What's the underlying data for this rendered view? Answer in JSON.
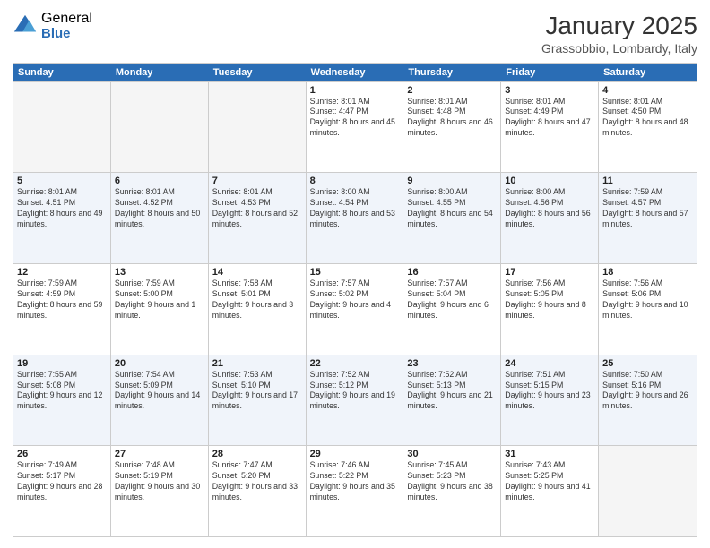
{
  "logo": {
    "general": "General",
    "blue": "Blue"
  },
  "title": "January 2025",
  "subtitle": "Grassobbio, Lombardy, Italy",
  "days": [
    "Sunday",
    "Monday",
    "Tuesday",
    "Wednesday",
    "Thursday",
    "Friday",
    "Saturday"
  ],
  "weeks": [
    [
      {
        "day": "",
        "empty": true
      },
      {
        "day": "",
        "empty": true
      },
      {
        "day": "",
        "empty": true
      },
      {
        "day": "1",
        "sunrise": "8:01 AM",
        "sunset": "4:47 PM",
        "daylight": "8 hours and 45 minutes."
      },
      {
        "day": "2",
        "sunrise": "8:01 AM",
        "sunset": "4:48 PM",
        "daylight": "8 hours and 46 minutes."
      },
      {
        "day": "3",
        "sunrise": "8:01 AM",
        "sunset": "4:49 PM",
        "daylight": "8 hours and 47 minutes."
      },
      {
        "day": "4",
        "sunrise": "8:01 AM",
        "sunset": "4:50 PM",
        "daylight": "8 hours and 48 minutes."
      }
    ],
    [
      {
        "day": "5",
        "sunrise": "8:01 AM",
        "sunset": "4:51 PM",
        "daylight": "8 hours and 49 minutes."
      },
      {
        "day": "6",
        "sunrise": "8:01 AM",
        "sunset": "4:52 PM",
        "daylight": "8 hours and 50 minutes."
      },
      {
        "day": "7",
        "sunrise": "8:01 AM",
        "sunset": "4:53 PM",
        "daylight": "8 hours and 52 minutes."
      },
      {
        "day": "8",
        "sunrise": "8:00 AM",
        "sunset": "4:54 PM",
        "daylight": "8 hours and 53 minutes."
      },
      {
        "day": "9",
        "sunrise": "8:00 AM",
        "sunset": "4:55 PM",
        "daylight": "8 hours and 54 minutes."
      },
      {
        "day": "10",
        "sunrise": "8:00 AM",
        "sunset": "4:56 PM",
        "daylight": "8 hours and 56 minutes."
      },
      {
        "day": "11",
        "sunrise": "7:59 AM",
        "sunset": "4:57 PM",
        "daylight": "8 hours and 57 minutes."
      }
    ],
    [
      {
        "day": "12",
        "sunrise": "7:59 AM",
        "sunset": "4:59 PM",
        "daylight": "8 hours and 59 minutes."
      },
      {
        "day": "13",
        "sunrise": "7:59 AM",
        "sunset": "5:00 PM",
        "daylight": "9 hours and 1 minute."
      },
      {
        "day": "14",
        "sunrise": "7:58 AM",
        "sunset": "5:01 PM",
        "daylight": "9 hours and 3 minutes."
      },
      {
        "day": "15",
        "sunrise": "7:57 AM",
        "sunset": "5:02 PM",
        "daylight": "9 hours and 4 minutes."
      },
      {
        "day": "16",
        "sunrise": "7:57 AM",
        "sunset": "5:04 PM",
        "daylight": "9 hours and 6 minutes."
      },
      {
        "day": "17",
        "sunrise": "7:56 AM",
        "sunset": "5:05 PM",
        "daylight": "9 hours and 8 minutes."
      },
      {
        "day": "18",
        "sunrise": "7:56 AM",
        "sunset": "5:06 PM",
        "daylight": "9 hours and 10 minutes."
      }
    ],
    [
      {
        "day": "19",
        "sunrise": "7:55 AM",
        "sunset": "5:08 PM",
        "daylight": "9 hours and 12 minutes."
      },
      {
        "day": "20",
        "sunrise": "7:54 AM",
        "sunset": "5:09 PM",
        "daylight": "9 hours and 14 minutes."
      },
      {
        "day": "21",
        "sunrise": "7:53 AM",
        "sunset": "5:10 PM",
        "daylight": "9 hours and 17 minutes."
      },
      {
        "day": "22",
        "sunrise": "7:52 AM",
        "sunset": "5:12 PM",
        "daylight": "9 hours and 19 minutes."
      },
      {
        "day": "23",
        "sunrise": "7:52 AM",
        "sunset": "5:13 PM",
        "daylight": "9 hours and 21 minutes."
      },
      {
        "day": "24",
        "sunrise": "7:51 AM",
        "sunset": "5:15 PM",
        "daylight": "9 hours and 23 minutes."
      },
      {
        "day": "25",
        "sunrise": "7:50 AM",
        "sunset": "5:16 PM",
        "daylight": "9 hours and 26 minutes."
      }
    ],
    [
      {
        "day": "26",
        "sunrise": "7:49 AM",
        "sunset": "5:17 PM",
        "daylight": "9 hours and 28 minutes."
      },
      {
        "day": "27",
        "sunrise": "7:48 AM",
        "sunset": "5:19 PM",
        "daylight": "9 hours and 30 minutes."
      },
      {
        "day": "28",
        "sunrise": "7:47 AM",
        "sunset": "5:20 PM",
        "daylight": "9 hours and 33 minutes."
      },
      {
        "day": "29",
        "sunrise": "7:46 AM",
        "sunset": "5:22 PM",
        "daylight": "9 hours and 35 minutes."
      },
      {
        "day": "30",
        "sunrise": "7:45 AM",
        "sunset": "5:23 PM",
        "daylight": "9 hours and 38 minutes."
      },
      {
        "day": "31",
        "sunrise": "7:43 AM",
        "sunset": "5:25 PM",
        "daylight": "9 hours and 41 minutes."
      },
      {
        "day": "",
        "empty": true
      }
    ]
  ]
}
